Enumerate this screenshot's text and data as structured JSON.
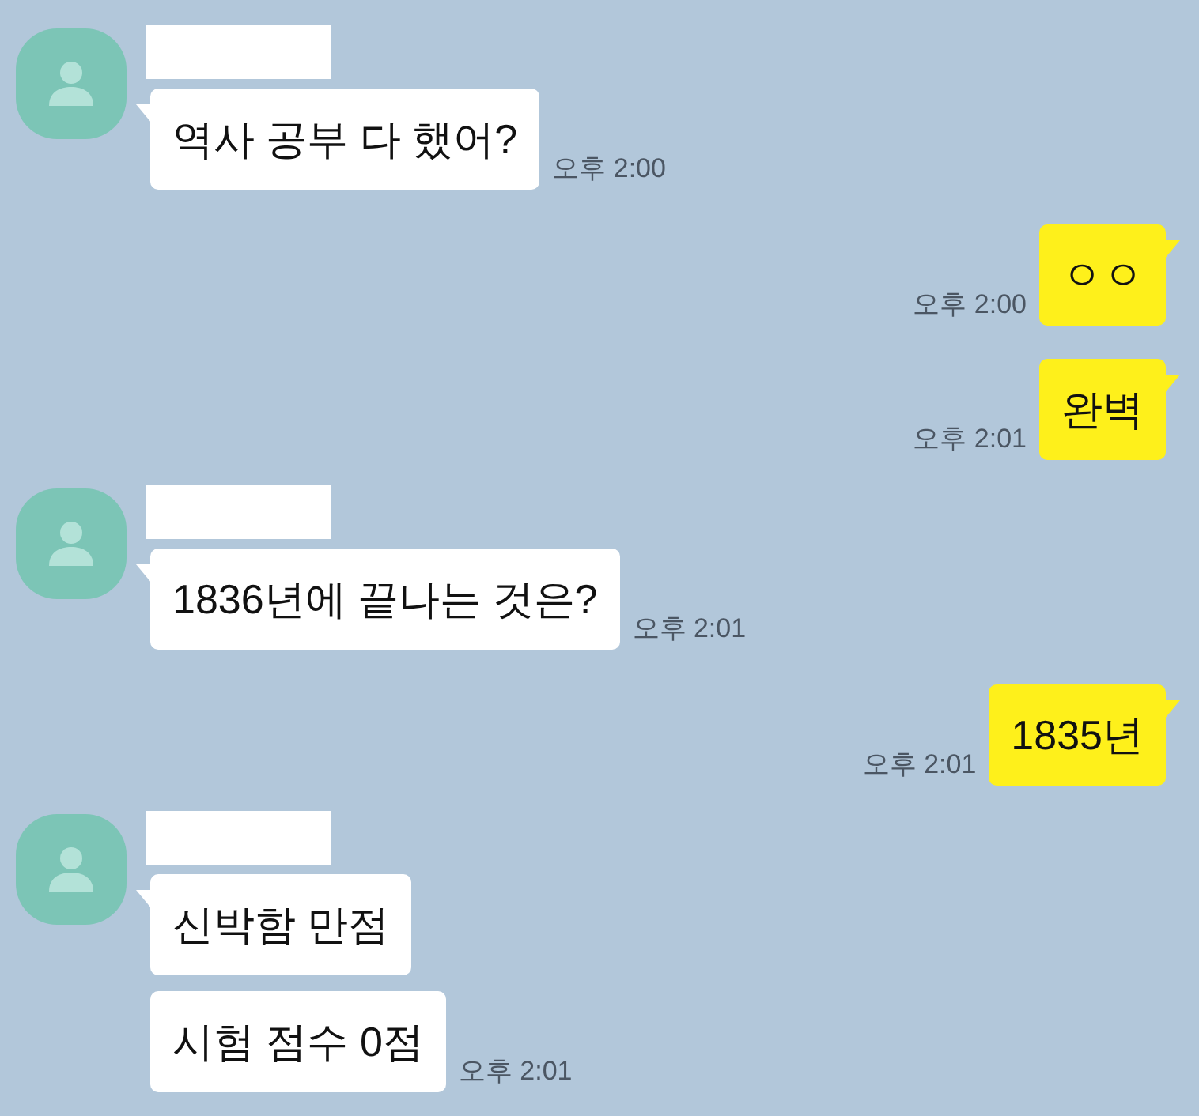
{
  "messages": [
    {
      "kind": "incoming",
      "bubbles": [
        "역사 공부 다 했어?"
      ],
      "time": "오후 2:00"
    },
    {
      "kind": "outgoing",
      "bubbles": [
        "ㅇㅇ"
      ],
      "time": "오후 2:00"
    },
    {
      "kind": "outgoing",
      "bubbles": [
        "완벽"
      ],
      "time": "오후 2:01"
    },
    {
      "kind": "incoming",
      "bubbles": [
        "1836년에 끝나는 것은?"
      ],
      "time": "오후 2:01"
    },
    {
      "kind": "outgoing",
      "bubbles": [
        "1835년"
      ],
      "time": "오후 2:01"
    },
    {
      "kind": "incoming",
      "bubbles": [
        "신박함 만점",
        "시험 점수 0점"
      ],
      "time": "오후 2:01"
    }
  ]
}
